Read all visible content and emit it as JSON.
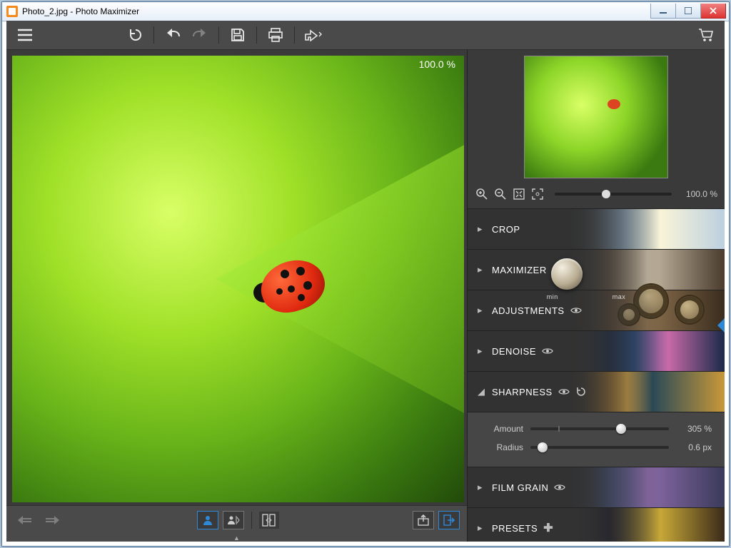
{
  "window": {
    "title": "Photo_2.jpg - Photo Maximizer"
  },
  "viewport": {
    "zoom_label": "100.0 %"
  },
  "navigator": {
    "zoom_label": "100.0 %"
  },
  "panels": {
    "crop": {
      "label": "CROP"
    },
    "maximizer": {
      "label": "MAXIMIZER",
      "min": "min",
      "max": "max"
    },
    "adjustments": {
      "label": "ADJUSTMENTS"
    },
    "denoise": {
      "label": "DENOISE"
    },
    "sharpness": {
      "label": "SHARPNESS",
      "amount": {
        "label": "Amount",
        "value": "305 %",
        "pos": 0.62
      },
      "radius": {
        "label": "Radius",
        "value": "0.6 px",
        "pos": 0.05
      }
    },
    "filmgrain": {
      "label": "FILM GRAIN"
    },
    "presets": {
      "label": "PRESETS"
    }
  }
}
